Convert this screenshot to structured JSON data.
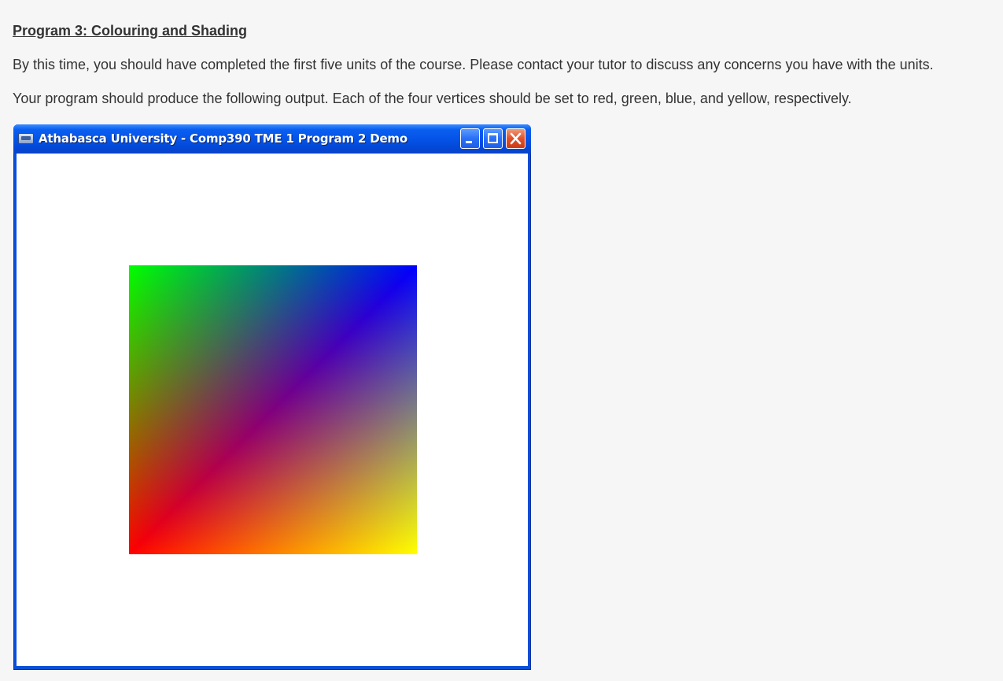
{
  "article": {
    "heading": "Program 3: Colouring and Shading",
    "paragraph1": "By this time, you should have completed the first five units of the course. Please contact your tutor to discuss any concerns you have with the units.",
    "paragraph2": "Your program should produce the following output. Each of the four vertices should be set to red, green, blue, and yellow, respectively."
  },
  "window": {
    "title": "Athabasca University - Comp390 TME 1 Program 2 Demo",
    "controls": [
      "minimize",
      "maximize",
      "close"
    ],
    "icon": "app-window-icon"
  },
  "render": {
    "vertex_colors": {
      "bottom_left": "#ff0000",
      "top_left": "#00ff00",
      "top_right": "#0000ff",
      "bottom_right": "#ffff00"
    },
    "background": "#ffffff"
  },
  "colors": {
    "page_background": "#f6f6f6",
    "text": "#333333",
    "titlebar": "#0553e8",
    "close_button": "#e0502b"
  }
}
